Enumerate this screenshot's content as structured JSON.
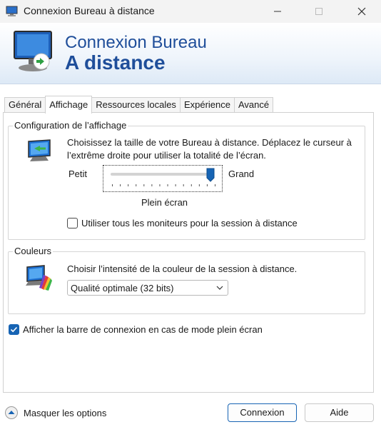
{
  "window": {
    "title": "Connexion Bureau à distance"
  },
  "banner": {
    "line1": "Connexion Bureau",
    "line2": "A distance"
  },
  "tabs": [
    {
      "label": "Général",
      "active": false
    },
    {
      "label": "Affichage",
      "active": true
    },
    {
      "label": "Ressources locales",
      "active": false
    },
    {
      "label": "Expérience",
      "active": false
    },
    {
      "label": "Avancé",
      "active": false
    }
  ],
  "display_config": {
    "title": "Configuration de l’affichage",
    "description": "Choisissez la taille de votre Bureau à distance. Déplacez le curseur à l’extrême droite pour utiliser la totalité de l’écran.",
    "slider": {
      "min_label": "Petit",
      "max_label": "Grand",
      "value_label": "Plein écran",
      "value_fraction": 1.0,
      "tick_count": 14
    },
    "all_monitors": {
      "label": "Utiliser tous les moniteurs pour la session à distance",
      "checked": false
    }
  },
  "colors": {
    "title": "Couleurs",
    "description": "Choisir l’intensité de la couleur de la session à distance.",
    "selected": "Qualité optimale (32 bits)"
  },
  "connection_bar": {
    "label": "Afficher la barre de connexion en cas de mode plein écran",
    "checked": true
  },
  "footer": {
    "options_label": "Masquer les options",
    "connect_label": "Connexion",
    "help_label": "Aide"
  },
  "theme": {
    "accent": "#1764b4",
    "banner_text": "#1f4e9a"
  }
}
